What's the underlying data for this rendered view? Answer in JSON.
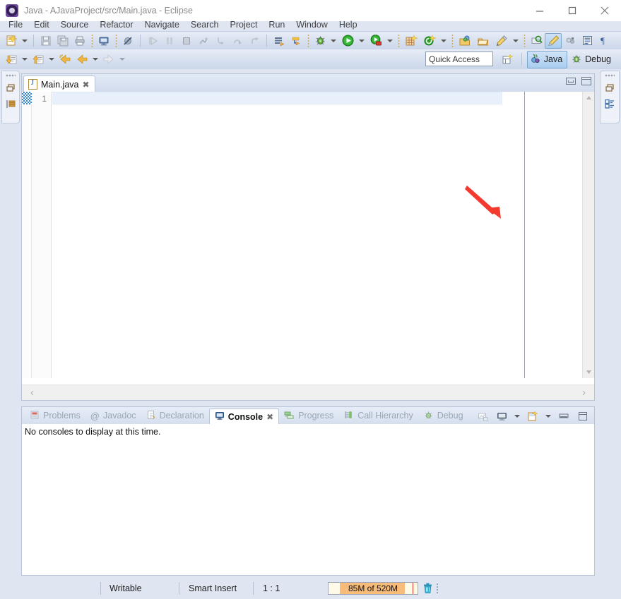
{
  "window": {
    "title": "Java - AJavaProject/src/Main.java - Eclipse",
    "app_icon": "eclipse-icon",
    "minimize_label": "—",
    "maximize_label": "□",
    "close_label": "✕"
  },
  "menubar": {
    "items": [
      {
        "label": "File"
      },
      {
        "label": "Edit"
      },
      {
        "label": "Source"
      },
      {
        "label": "Refactor"
      },
      {
        "label": "Navigate"
      },
      {
        "label": "Search"
      },
      {
        "label": "Project"
      },
      {
        "label": "Run"
      },
      {
        "label": "Window"
      },
      {
        "label": "Help"
      }
    ]
  },
  "toolbar_main": {
    "icons": [
      "new-wizard-icon",
      "save-icon",
      "save-all-icon",
      "print-icon",
      "open-console-icon",
      "skip-breakpoints-icon",
      "resume-icon",
      "suspend-icon",
      "terminate-icon",
      "disconnect-icon",
      "step-into-icon",
      "step-over-icon",
      "step-return-icon",
      "new-java-package-icon",
      "new-java-class-icon",
      "debug-icon",
      "run-icon",
      "run-coverage-icon",
      "new-java-project-icon",
      "new-annotation-icon",
      "open-type-icon",
      "open-task-icon",
      "pencil-icon",
      "search-icon",
      "paint-icon",
      "link-icon",
      "outline-icon",
      "paragraph-icon"
    ]
  },
  "toolbar_secondary": {
    "icons": [
      "next-annotation-icon",
      "previous-annotation-icon",
      "last-edit-location-icon",
      "back-icon",
      "forward-icon"
    ]
  },
  "quick_access": {
    "placeholder": "Quick Access",
    "value": "Quick Access"
  },
  "perspectives": {
    "open_perspective_icon": "open-perspective-icon",
    "items": [
      {
        "label": "Java",
        "icon": "java-perspective-icon",
        "selected": true
      },
      {
        "label": "Debug",
        "icon": "debug-perspective-icon",
        "selected": false
      }
    ]
  },
  "fastview_left": {
    "icons": [
      "restore-icon",
      "package-explorer-icon"
    ]
  },
  "fastview_right": {
    "icons": [
      "restore-icon",
      "outline-view-icon"
    ]
  },
  "editor": {
    "tab": {
      "label": "Main.java",
      "icon": "java-file-icon",
      "close_label": "✖"
    },
    "minimize_title": "Minimize",
    "maximize_title": "Maximize",
    "line_numbers": [
      "1"
    ],
    "content_lines": [
      ""
    ],
    "scroll_up": "⌃",
    "scroll_down": "⌄",
    "scroll_left": "‹",
    "scroll_right": "›"
  },
  "bottom_panel": {
    "tabs": [
      {
        "label": "Problems",
        "icon": "problems-icon",
        "selected": false
      },
      {
        "label": "Javadoc",
        "icon": "javadoc-icon",
        "selected": false
      },
      {
        "label": "Declaration",
        "icon": "declaration-icon",
        "selected": false
      },
      {
        "label": "Console",
        "icon": "console-icon",
        "selected": true,
        "close_label": "✖"
      },
      {
        "label": "Progress",
        "icon": "progress-icon",
        "selected": false
      },
      {
        "label": "Call Hierarchy",
        "icon": "call-hierarchy-icon",
        "selected": false
      },
      {
        "label": "Debug",
        "icon": "debug-view-icon",
        "selected": false
      }
    ],
    "toolbar_icons": [
      "pin-console-icon",
      "display-selected-console-icon",
      "display-dropdown-icon",
      "open-console-icon",
      "open-console-dropdown-icon",
      "minimize-icon",
      "maximize-icon"
    ],
    "message": "No consoles to display at this time."
  },
  "statusbar": {
    "writable": "Writable",
    "insert_mode": "Smart Insert",
    "position": "1 : 1",
    "heap": {
      "label": "85M of 520M",
      "used_mb": 85,
      "total_mb": 520,
      "fill_color": "#f7bb7a"
    },
    "trash_icon": "trash-icon"
  },
  "annotation": {
    "arrow_color": "#f4392f",
    "type": "red-arrow-pointing-down-right"
  }
}
